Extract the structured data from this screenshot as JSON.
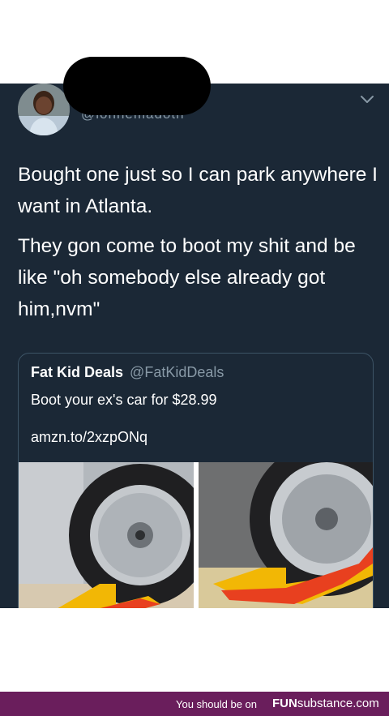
{
  "tweet": {
    "handle": "@lonnemadoth",
    "paragraphs": [
      "Bought one just so I can park anywhere I want in Atlanta.",
      "They gon come to boot my shit and be like \"oh somebody else already got him,nvm\""
    ]
  },
  "quote": {
    "name": "Fat Kid Deals",
    "handle": "@FatKidDeals",
    "text": "Boot your ex's car for $28.99",
    "link": "amzn.to/2xzpONq"
  },
  "footer": {
    "message": "You should be on",
    "brand_bold": "FUN",
    "brand_light": "substance",
    "brand_suffix": ".com"
  },
  "colors": {
    "tweet_bg": "#1b2836",
    "footer_bg": "#6a1e5c",
    "muted_text": "#8899a6",
    "boot_yellow": "#f2b705",
    "boot_red": "#e8401f"
  }
}
